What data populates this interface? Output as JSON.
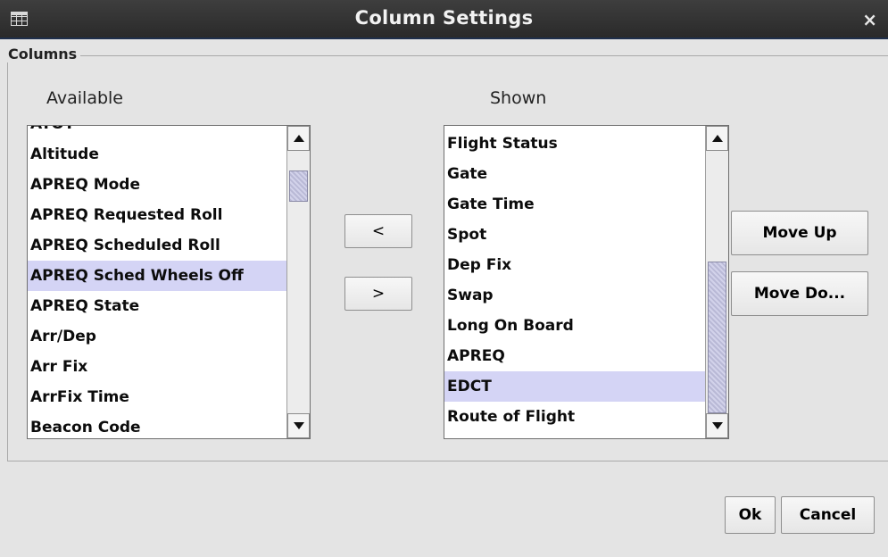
{
  "window": {
    "title": "Column Settings",
    "icon": "table-icon",
    "close_icon": "close-icon",
    "close_glyph": "×"
  },
  "group": {
    "title": "Columns"
  },
  "available": {
    "heading": "Available",
    "items": [
      "ATOT",
      "Altitude",
      "APREQ Mode",
      "APREQ Requested Roll",
      "APREQ Scheduled Roll",
      "APREQ Sched Wheels Off",
      "APREQ State",
      "Arr/Dep",
      "Arr Fix",
      "ArrFix Time",
      "Beacon Code"
    ],
    "selected": "APREQ Sched Wheels Off"
  },
  "shown": {
    "heading": "Shown",
    "items": [
      "Flight Status",
      "Gate",
      "Gate Time",
      "Spot",
      "Dep Fix",
      "Swap",
      "Long On Board",
      "APREQ",
      "EDCT",
      "Route of Flight"
    ],
    "selected": "EDCT"
  },
  "buttons": {
    "remove": "<",
    "add": ">",
    "move_up": "Move Up",
    "move_down": "Move Do...",
    "ok": "Ok",
    "cancel": "Cancel"
  },
  "colors": {
    "selection": "#d4d4f5",
    "titlebar": "#2e2e2e",
    "background": "#e4e4e4"
  }
}
